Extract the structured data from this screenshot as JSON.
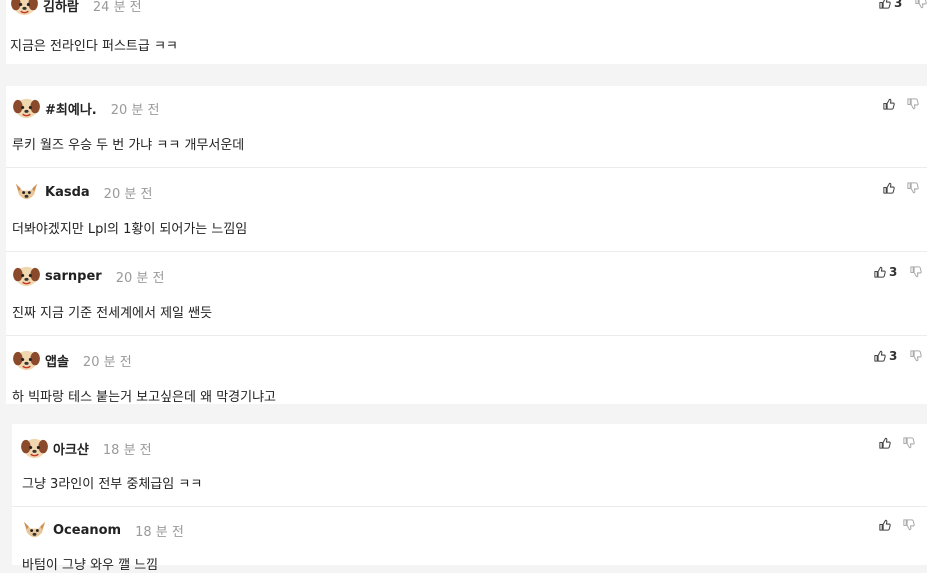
{
  "comments": [
    {
      "name": "김하람",
      "time": "24 분 전",
      "text": "지금은 전라인다 퍼스트급 ㅋㅋ",
      "likes": "3",
      "avatar": "dog-avatar-icon"
    },
    {
      "name": "#최예나.",
      "time": "20 분 전",
      "text": "루키 월즈 우승 두 번 가냐 ㅋㅋ 개무서운데",
      "likes": "",
      "avatar": "dog-avatar-icon"
    },
    {
      "name": "Kasda",
      "time": "20 분 전",
      "text": "더봐야겠지만 Lpl의 1황이 되어가는 느낌임",
      "likes": "",
      "avatar": "fox-avatar-icon"
    },
    {
      "name": "sarnper",
      "time": "20 분 전",
      "text": "진짜 지금 기준 전세계에서 제일 쌘듯",
      "likes": "3",
      "avatar": "dog-avatar-icon"
    },
    {
      "name": "앱솔",
      "time": "20 분 전",
      "text": "하 빅파랑 테스 붙는거 보고싶은데 왜 막경기냐고",
      "likes": "3",
      "avatar": "dog-avatar-icon"
    },
    {
      "name": "아크샨",
      "time": "18 분 전",
      "text": "그냥 3라인이 전부 중체급임 ㅋㅋ",
      "likes": "",
      "avatar": "dog-avatar-icon"
    },
    {
      "name": "Oceanom",
      "time": "18 분 전",
      "text": "바텀이 그냥 와우 깰 느낌",
      "likes": "",
      "avatar": "fox-avatar-icon"
    }
  ]
}
